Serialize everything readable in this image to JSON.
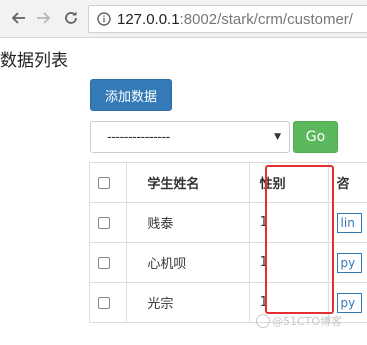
{
  "browser": {
    "url_host": "127.0.0.1",
    "url_rest": ":8002/stark/crm/customer/"
  },
  "page": {
    "title": "数据列表",
    "add_button_label": "添加数据",
    "filter_select_value": "---------------",
    "go_button_label": "Go"
  },
  "table": {
    "headers": [
      "",
      "学生姓名",
      "性别",
      "咨"
    ],
    "rows": [
      {
        "name": "贱泰",
        "gender": "1",
        "source": "lin"
      },
      {
        "name": "心机呗",
        "gender": "1",
        "source": "py"
      },
      {
        "name": "光宗",
        "gender": "1",
        "source": "py"
      }
    ]
  },
  "watermark": "@51CTO博客",
  "colors": {
    "primary": "#337ab7",
    "success": "#5cb85c",
    "highlight": "#e4312f"
  }
}
